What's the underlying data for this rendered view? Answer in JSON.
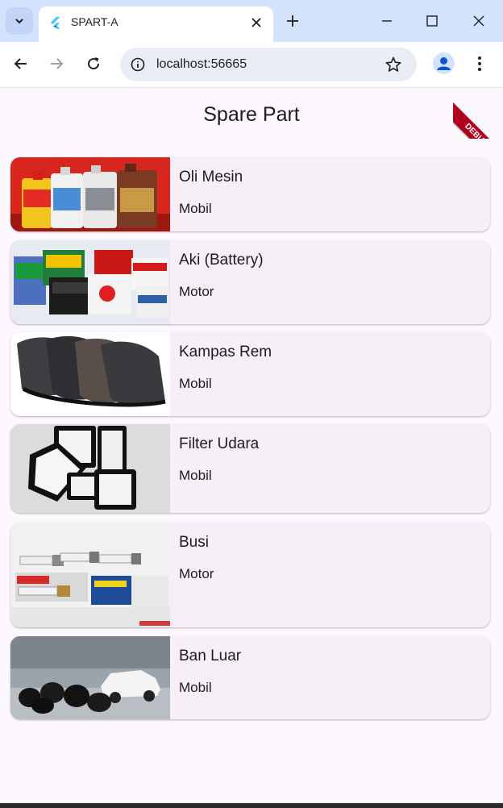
{
  "browser": {
    "tab_title": "SPART-A",
    "url": "localhost:56665"
  },
  "app": {
    "title": "Spare Part",
    "debug_label": "DEBUG"
  },
  "products": [
    {
      "name": "Oli Mesin",
      "type": "Mobil",
      "image": "engine-oil-bottles"
    },
    {
      "name": "Aki (Battery)",
      "type": "Motor",
      "image": "car-batteries"
    },
    {
      "name": "Kampas Rem",
      "type": "Mobil",
      "image": "brake-pads"
    },
    {
      "name": "Filter Udara",
      "type": "Mobil",
      "image": "air-filters"
    },
    {
      "name": "Busi",
      "type": "Motor",
      "image": "spark-plugs"
    },
    {
      "name": "Ban Luar",
      "type": "Mobil",
      "image": "tires-and-car"
    }
  ],
  "colors": {
    "background": "#fdf7fe",
    "card": "#f6eff8",
    "tabbar": "#d3e3fd",
    "debug_ribbon": "#b00020"
  }
}
